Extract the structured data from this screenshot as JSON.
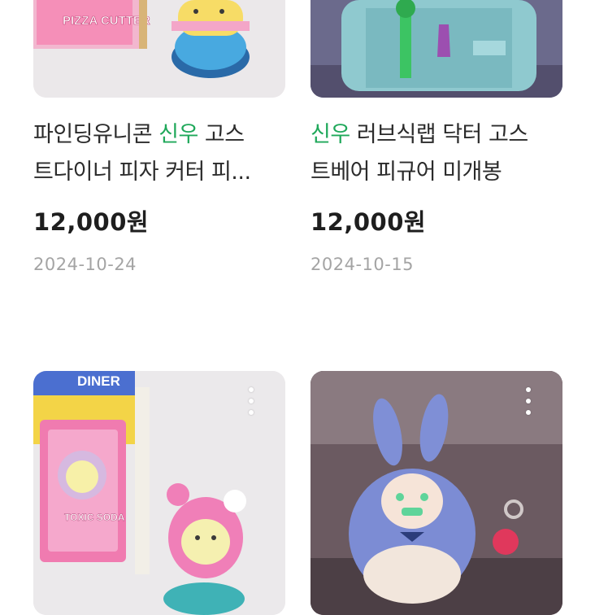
{
  "products": [
    {
      "title_line1_pre": "파인딩유니콘 ",
      "title_line1_kw": "신우",
      "title_line1_post": " 고스",
      "title_line2": "트다이너 피자 커터 피...",
      "price": "12,000원",
      "date": "2024-10-24",
      "box_text": "PIZZA CUTTER"
    },
    {
      "title_line1_pre": "",
      "title_line1_kw": "신우",
      "title_line1_post": " 러브식랩 닥터 고스",
      "title_line2": "트베어 피규어 미개봉",
      "price": "12,000원",
      "date": "2024-10-15"
    },
    {
      "card_text": "TOXIC SODA",
      "box_text": "DINER"
    },
    {}
  ],
  "icons": {
    "more": "more-vertical-icon"
  },
  "colors": {
    "keyword": "#1fa85a",
    "price": "#1e1e1e",
    "date": "#a4a4a4"
  }
}
